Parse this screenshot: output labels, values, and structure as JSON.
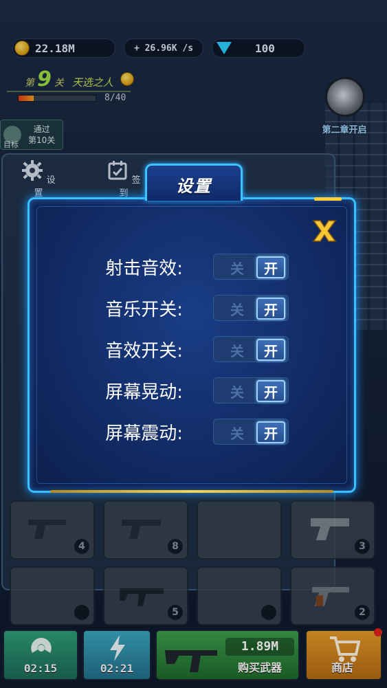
{
  "hud": {
    "coins": "22.18M",
    "income_rate": "+ 26.96K /s",
    "gems": "100",
    "level_prefix": "第",
    "level_number": "9",
    "level_suffix": "关",
    "level_name": "天选之人",
    "level_progress_text": "8/40",
    "level_progress_fraction": 0.2,
    "chapter_label": "第二章开启",
    "goal_label": "目标",
    "goal_text_line1": "通过",
    "goal_text_line2": "第10关"
  },
  "side_menu": {
    "settings_label": "设置",
    "checkin_label": "签到"
  },
  "settings_dialog": {
    "title": "设置",
    "close_label": "X",
    "rows": [
      {
        "label": "射击音效:",
        "off": "关",
        "on": "开"
      },
      {
        "label": "音乐开关:",
        "off": "关",
        "on": "开"
      },
      {
        "label": "音效开关:",
        "off": "关",
        "on": "开"
      },
      {
        "label": "屏幕晃动:",
        "off": "关",
        "on": "开"
      },
      {
        "label": "屏幕震动:",
        "off": "关",
        "on": "开"
      }
    ]
  },
  "weapon_grid": {
    "cells": [
      {
        "level": "4"
      },
      {
        "level": "8"
      },
      {
        "level": ""
      },
      {
        "level": "3"
      },
      {
        "level": ""
      },
      {
        "level": "5"
      },
      {
        "level": ""
      },
      {
        "level": "2"
      }
    ]
  },
  "bottom_bar": {
    "boost1_time": "02:15",
    "boost2_time": "02:21",
    "buy_price": "1.89M",
    "buy_label": "购买武器",
    "shop_label": "商店"
  },
  "colors": {
    "dialog_border": "#39c0ff",
    "dialog_bg": "#112a63",
    "toggle_on_border": "#9fd2ff",
    "close_gold": "#f5c53a"
  }
}
